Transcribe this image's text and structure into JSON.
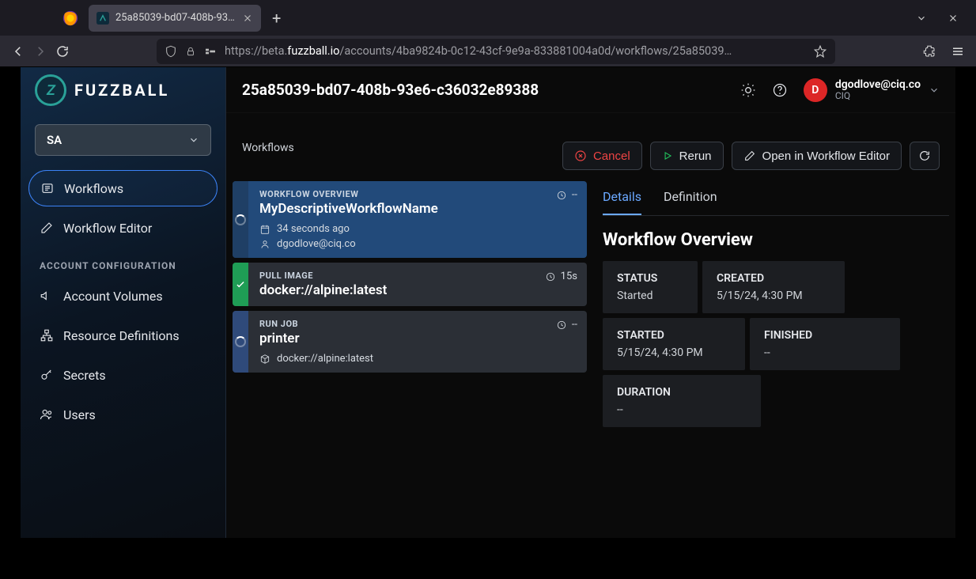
{
  "browser": {
    "tab_title": "25a85039-bd07-408b-93…",
    "url_proto": "https://beta.",
    "url_host": "fuzzball.io",
    "url_path": "/accounts/4ba9824b-0c12-43cf-9e9a-833881004a0d/workflows/25a85039…"
  },
  "brand": {
    "name": "FUZZBALL"
  },
  "org_select": {
    "value": "SA"
  },
  "sidebar": {
    "items": [
      {
        "label": "Workflows"
      },
      {
        "label": "Workflow Editor"
      }
    ],
    "section_label": "ACCOUNT CONFIGURATION",
    "config_items": [
      {
        "label": "Account Volumes"
      },
      {
        "label": "Resource Definitions"
      },
      {
        "label": "Secrets"
      },
      {
        "label": "Users"
      }
    ]
  },
  "topbar": {
    "title": "25a85039-bd07-408b-93e6-c36032e89388",
    "user_email": "dgodlove@ciq.co",
    "user_org": "CIQ",
    "avatar_initial": "D"
  },
  "crumbs": {
    "text": "Workflows"
  },
  "actions": {
    "cancel": "Cancel",
    "rerun": "Rerun",
    "open_editor": "Open in Workflow Editor"
  },
  "steps": {
    "overview": {
      "label": "WORKFLOW OVERVIEW",
      "title": "MyDescriptiveWorkflowName",
      "age": "34 seconds ago",
      "user": "dgodlove@ciq.co",
      "time": "--"
    },
    "pull": {
      "label": "PULL IMAGE",
      "title": "docker://alpine:latest",
      "time": "15s"
    },
    "run": {
      "label": "RUN JOB",
      "title": "printer",
      "image": "docker://alpine:latest",
      "time": "--"
    }
  },
  "tabs": {
    "details": "Details",
    "definition": "Definition"
  },
  "details": {
    "title": "Workflow Overview",
    "stats": {
      "status_label": "STATUS",
      "status_val": "Started",
      "created_label": "CREATED",
      "created_val": "5/15/24, 4:30 PM",
      "started_label": "STARTED",
      "started_val": "5/15/24, 4:30 PM",
      "finished_label": "FINISHED",
      "finished_val": "--",
      "duration_label": "DURATION",
      "duration_val": "--"
    }
  }
}
